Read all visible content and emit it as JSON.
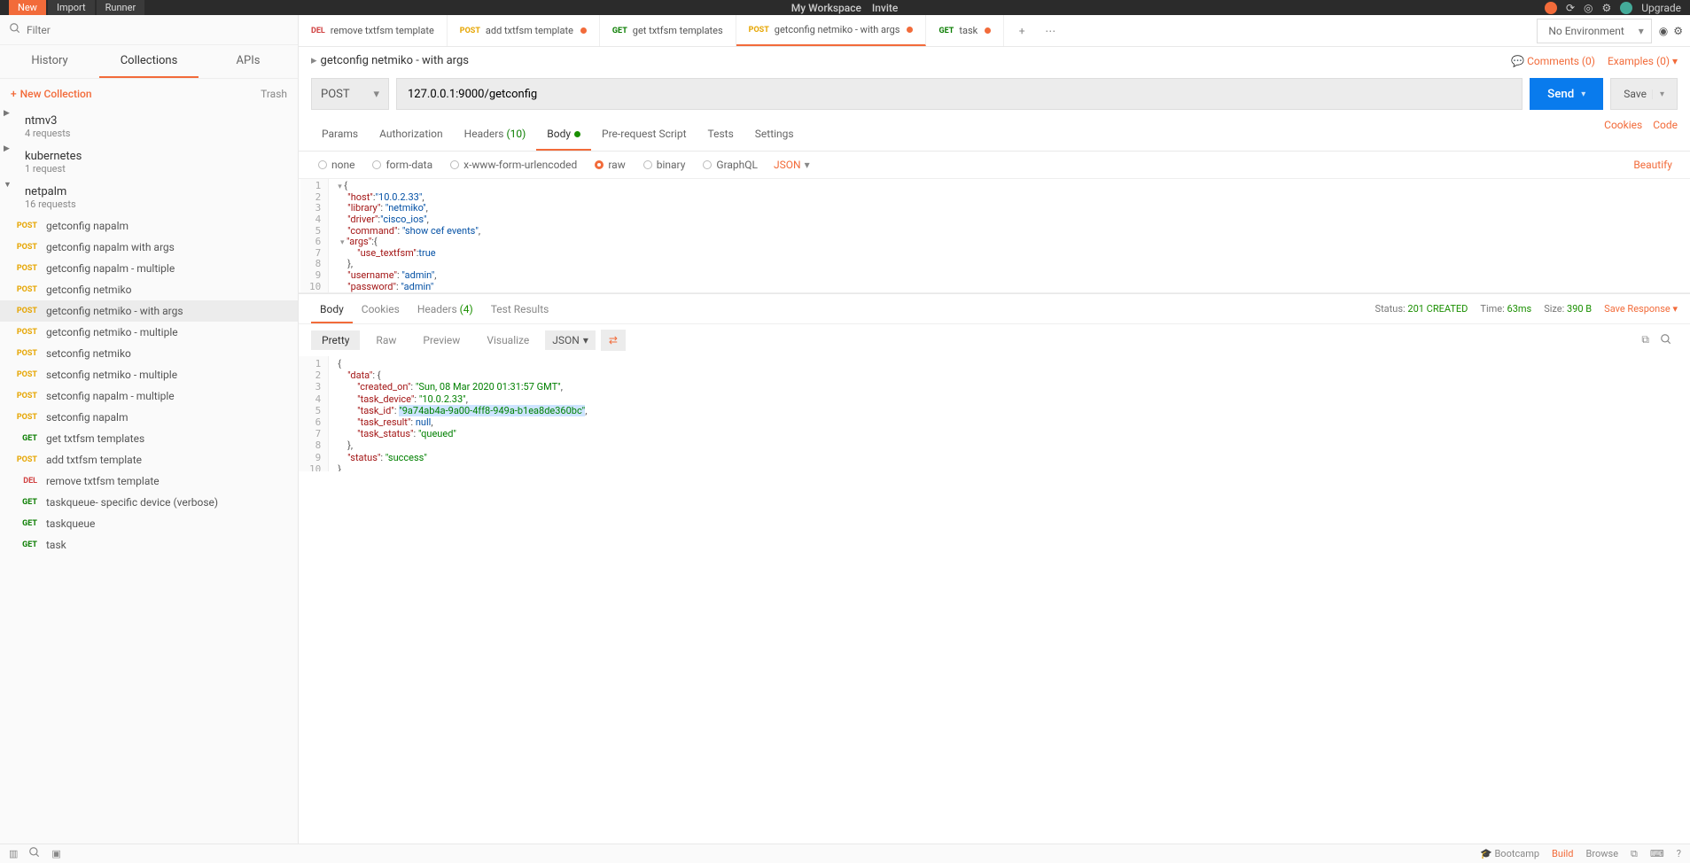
{
  "top": {
    "workspace": "My Workspace",
    "invite": "Invite"
  },
  "sidebar": {
    "filter_placeholder": "Filter",
    "tabs": {
      "history": "History",
      "collections": "Collections",
      "apis": "APIs"
    },
    "new_collection": "New Collection",
    "trash": "Trash",
    "collections": [
      {
        "name": "ntmv3",
        "meta": "4 requests"
      },
      {
        "name": "kubernetes",
        "meta": "1 request"
      },
      {
        "name": "netpalm",
        "meta": "16 requests"
      }
    ],
    "requests": [
      {
        "method": "POST",
        "name": "getconfig napalm"
      },
      {
        "method": "POST",
        "name": "getconfig napalm with args"
      },
      {
        "method": "POST",
        "name": "getconfig napalm - multiple"
      },
      {
        "method": "POST",
        "name": "getconfig netmiko"
      },
      {
        "method": "POST",
        "name": "getconfig netmiko - with args",
        "selected": true
      },
      {
        "method": "POST",
        "name": "getconfig netmiko - multiple"
      },
      {
        "method": "POST",
        "name": "setconfig netmiko"
      },
      {
        "method": "POST",
        "name": "setconfig netmiko - multiple"
      },
      {
        "method": "POST",
        "name": "setconfig napalm - multiple"
      },
      {
        "method": "POST",
        "name": "setconfig napalm"
      },
      {
        "method": "GET",
        "name": "get txtfsm templates"
      },
      {
        "method": "POST",
        "name": "add txtfsm template"
      },
      {
        "method": "DEL",
        "name": "remove txtfsm template"
      },
      {
        "method": "GET",
        "name": "taskqueue- specific device (verbose)"
      },
      {
        "method": "GET",
        "name": "taskqueue"
      },
      {
        "method": "GET",
        "name": "task"
      }
    ]
  },
  "tabs": [
    {
      "method": "DEL",
      "label": "remove txtfsm template"
    },
    {
      "method": "POST",
      "label": "add txtfsm template",
      "dirty": true
    },
    {
      "method": "GET",
      "label": "get txtfsm templates"
    },
    {
      "method": "POST",
      "label": "getconfig netmiko - with args",
      "dirty": true,
      "active": true
    },
    {
      "method": "GET",
      "label": "task",
      "dirty": true
    }
  ],
  "env": {
    "selected": "No Environment"
  },
  "breadcrumb": "getconfig netmiko - with args",
  "comments": "Comments (0)",
  "examples": "Examples (0)",
  "request": {
    "method": "POST",
    "url": "127.0.0.1:9000/getconfig",
    "send": "Send",
    "save": "Save"
  },
  "reqTabs": {
    "params": "Params",
    "auth": "Authorization",
    "headers": "Headers",
    "headers_count": "(10)",
    "body": "Body",
    "prereq": "Pre-request Script",
    "tests": "Tests",
    "settings": "Settings",
    "cookies": "Cookies",
    "code": "Code"
  },
  "bodyOptions": {
    "none": "none",
    "formdata": "form-data",
    "urlenc": "x-www-form-urlencoded",
    "raw": "raw",
    "binary": "binary",
    "graphql": "GraphQL",
    "format": "JSON",
    "beautify": "Beautify"
  },
  "requestBody": {
    "host": "10.0.2.33",
    "library": "netmiko",
    "driver": "cisco_ios",
    "command": "show cef events",
    "use_textfsm": "true",
    "username": "admin",
    "password": "admin"
  },
  "resTabs": {
    "body": "Body",
    "cookies": "Cookies",
    "headers": "Headers",
    "headers_count": "(4)",
    "testresults": "Test Results"
  },
  "resMeta": {
    "status_label": "Status:",
    "status_value": "201 CREATED",
    "time_label": "Time:",
    "time_value": "63ms",
    "size_label": "Size:",
    "size_value": "390 B",
    "save": "Save Response"
  },
  "resFormat": {
    "pretty": "Pretty",
    "raw": "Raw",
    "preview": "Preview",
    "visualize": "Visualize",
    "type": "JSON"
  },
  "responseBody": {
    "created_on": "Sun, 08 Mar 2020 01:31:57 GMT",
    "task_device": "10.0.2.33",
    "task_id": "9a74ab4a-9a00-4ff8-949a-b1ea8de360bc",
    "task_result": "null",
    "task_status": "queued",
    "status": "success"
  },
  "statusBar": {
    "bootcamp": "Bootcamp",
    "build": "Build",
    "browse": "Browse"
  }
}
